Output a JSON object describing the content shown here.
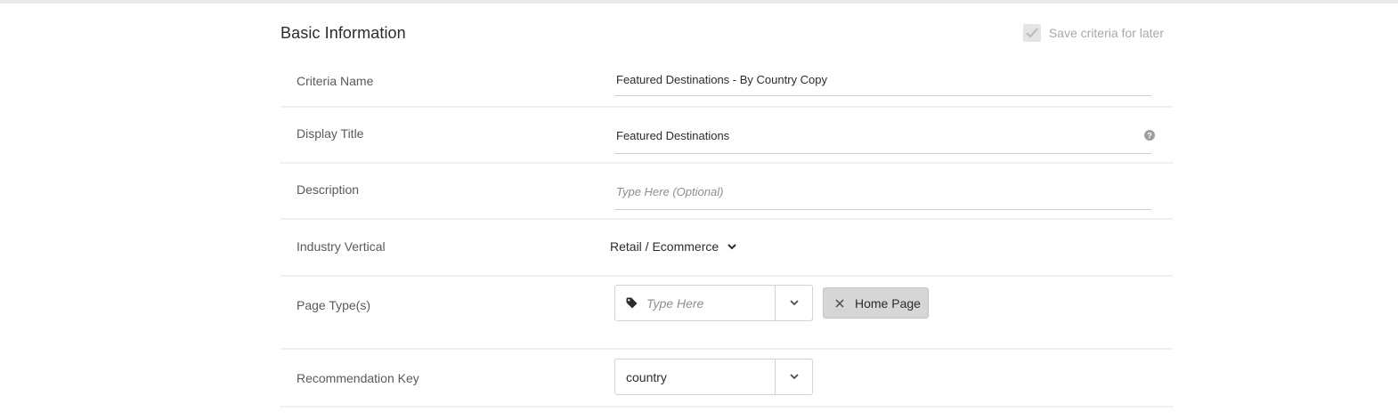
{
  "section": {
    "title": "Basic Information",
    "save_criteria_label": "Save criteria for later",
    "save_criteria_checked": true
  },
  "fields": {
    "criteria_name": {
      "label": "Criteria Name",
      "value": "Featured Destinations - By Country Copy"
    },
    "display_title": {
      "label": "Display Title",
      "value": "Featured Destinations"
    },
    "description": {
      "label": "Description",
      "placeholder": "Type Here (Optional)"
    },
    "industry_vertical": {
      "label": "Industry Vertical",
      "value": "Retail / Ecommerce"
    },
    "page_types": {
      "label": "Page Type(s)",
      "placeholder": "Type Here",
      "tags": [
        "Home Page"
      ]
    },
    "recommendation_key": {
      "label": "Recommendation Key",
      "value": "country"
    }
  },
  "icons": {
    "checkbox": "checkmark-icon",
    "help": "question-circle-icon",
    "dropdown": "chevron-down-icon",
    "tag": "tag-icon",
    "remove": "close-icon"
  },
  "colors": {
    "tag_background": "#d6d6d6",
    "divider": "#efefef",
    "checkbox_disabled": "#e4e4e4"
  }
}
